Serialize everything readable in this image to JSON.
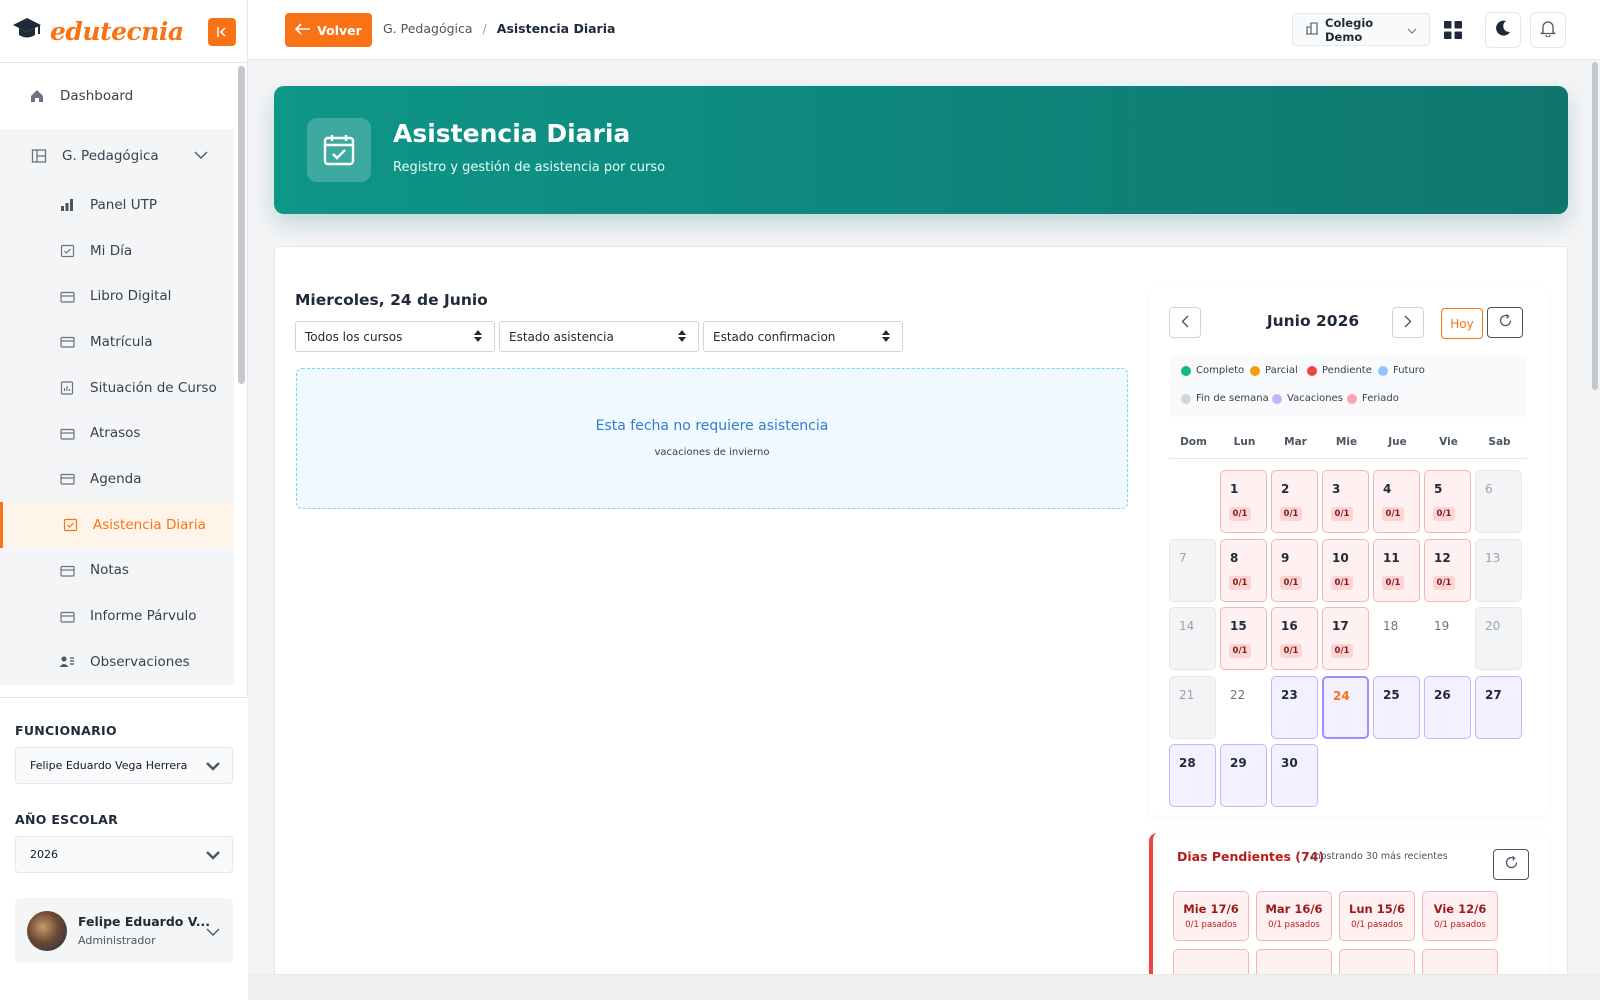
{
  "app": {
    "logo": "edutecnia"
  },
  "sidebar": {
    "items": [
      {
        "label": "Dashboard",
        "icon": "home-icon"
      },
      {
        "label": "G. Pedagógica",
        "icon": "layout-icon"
      },
      {
        "label": "Panel UTP",
        "icon": "bar-chart-icon"
      },
      {
        "label": "Mi Día",
        "icon": "calendar-check-icon"
      },
      {
        "label": "Libro Digital",
        "icon": "folder-icon"
      },
      {
        "label": "Matrícula",
        "icon": "folder-icon"
      },
      {
        "label": "Situación de Curso",
        "icon": "report-icon"
      },
      {
        "label": "Atrasos",
        "icon": "folder-icon"
      },
      {
        "label": "Agenda",
        "icon": "folder-icon"
      },
      {
        "label": "Asistencia Diaria",
        "icon": "calendar-check-icon"
      },
      {
        "label": "Notas",
        "icon": "folder-icon"
      },
      {
        "label": "Informe Párvulo",
        "icon": "folder-icon"
      },
      {
        "label": "Observaciones",
        "icon": "users-icon"
      }
    ],
    "funcionario_label": "FUNCIONARIO",
    "funcionario_value": "Felipe Eduardo Vega Herrera",
    "year_label": "AÑO ESCOLAR",
    "year_value": "2026",
    "user_name": "Felipe Eduardo V...",
    "user_role": "Administrador"
  },
  "topbar": {
    "back_label": "Volver",
    "crumb_parent": "G. Pedagógica",
    "crumb_sep": "/",
    "crumb_current": "Asistencia Diaria",
    "school": "Colegio Demo"
  },
  "hero": {
    "title": "Asistencia Diaria",
    "subtitle": "Registro y gestión de asistencia por curso"
  },
  "main": {
    "date_title": "Miercoles, 24 de Junio",
    "filters": [
      "Todos los cursos",
      "Estado asistencia",
      "Estado confirmacion"
    ],
    "notice_title": "Esta fecha no requiere asistencia",
    "notice_sub": "vacaciones de invierno"
  },
  "calendar": {
    "month": "Junio 2026",
    "today_label": "Hoy",
    "legend": [
      {
        "label": "Completo",
        "color": "#10b981"
      },
      {
        "label": "Parcial",
        "color": "#f59e0b"
      },
      {
        "label": "Pendiente",
        "color": "#ef4444"
      },
      {
        "label": "Futuro",
        "color": "#93c5fd"
      },
      {
        "label": "Fin de semana",
        "color": "#d1d5db"
      },
      {
        "label": "Vacaciones",
        "color": "#c4b5fd"
      },
      {
        "label": "Feriado",
        "color": "#fda4af"
      }
    ],
    "weekdays": [
      "Dom",
      "Lun",
      "Mar",
      "Mie",
      "Jue",
      "Vie",
      "Sab"
    ],
    "first_weekday": 1,
    "days": [
      {
        "n": "1",
        "s": "pend",
        "b": "0/1"
      },
      {
        "n": "2",
        "s": "pend",
        "b": "0/1"
      },
      {
        "n": "3",
        "s": "pend",
        "b": "0/1"
      },
      {
        "n": "4",
        "s": "pend",
        "b": "0/1"
      },
      {
        "n": "5",
        "s": "pend",
        "b": "0/1"
      },
      {
        "n": "6",
        "s": "weekend"
      },
      {
        "n": "7",
        "s": "weekend"
      },
      {
        "n": "8",
        "s": "pend",
        "b": "0/1"
      },
      {
        "n": "9",
        "s": "pend",
        "b": "0/1"
      },
      {
        "n": "10",
        "s": "pend",
        "b": "0/1"
      },
      {
        "n": "11",
        "s": "pend",
        "b": "0/1"
      },
      {
        "n": "12",
        "s": "pend",
        "b": "0/1"
      },
      {
        "n": "13",
        "s": "weekend"
      },
      {
        "n": "14",
        "s": "weekend"
      },
      {
        "n": "15",
        "s": "pend",
        "b": "0/1"
      },
      {
        "n": "16",
        "s": "pend",
        "b": "0/1"
      },
      {
        "n": "17",
        "s": "pend",
        "b": "0/1"
      },
      {
        "n": "18",
        "s": "plain"
      },
      {
        "n": "19",
        "s": "plain"
      },
      {
        "n": "20",
        "s": "weekend"
      },
      {
        "n": "21",
        "s": "weekend"
      },
      {
        "n": "22",
        "s": "plain"
      },
      {
        "n": "23",
        "s": "vac"
      },
      {
        "n": "24",
        "s": "today"
      },
      {
        "n": "25",
        "s": "vac"
      },
      {
        "n": "26",
        "s": "vac"
      },
      {
        "n": "27",
        "s": "vac"
      },
      {
        "n": "28",
        "s": "vac"
      },
      {
        "n": "29",
        "s": "vac"
      },
      {
        "n": "30",
        "s": "vac"
      }
    ]
  },
  "pending": {
    "title": "Dias Pendientes (74)",
    "note": "- mostrando 30 más recientes",
    "items": [
      {
        "d": "Mie 17/6",
        "s": "0/1 pasados"
      },
      {
        "d": "Mar 16/6",
        "s": "0/1 pasados"
      },
      {
        "d": "Lun 15/6",
        "s": "0/1 pasados"
      },
      {
        "d": "Vie 12/6",
        "s": "0/1 pasados"
      }
    ]
  }
}
